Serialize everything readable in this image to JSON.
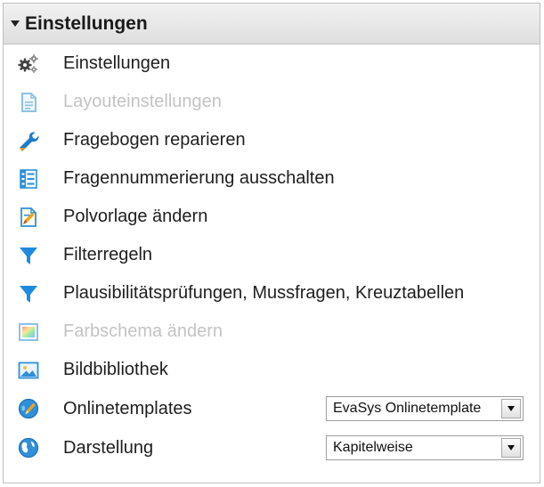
{
  "panel": {
    "title": "Einstellungen"
  },
  "items": [
    {
      "label": "Einstellungen",
      "icon": "gears-icon",
      "enabled": true
    },
    {
      "label": "Layouteinstellungen",
      "icon": "document-icon",
      "enabled": false
    },
    {
      "label": "Fragebogen reparieren",
      "icon": "wrench-icon",
      "enabled": true
    },
    {
      "label": "Fragennummerierung ausschalten",
      "icon": "numbered-list-icon",
      "enabled": true
    },
    {
      "label": "Polvorlage ändern",
      "icon": "template-edit-icon",
      "enabled": true
    },
    {
      "label": "Filterregeln",
      "icon": "filter-icon",
      "enabled": true
    },
    {
      "label": "Plausibilitätsprüfungen, Mussfragen, Kreuztabellen",
      "icon": "filter-icon",
      "enabled": true
    },
    {
      "label": "Farbschema ändern",
      "icon": "color-palette-icon",
      "enabled": false
    },
    {
      "label": "Bildbibliothek",
      "icon": "image-icon",
      "enabled": true
    },
    {
      "label": "Onlinetemplates",
      "icon": "globe-pencil-icon",
      "enabled": true,
      "select_value": "EvaSys Onlinetemplate"
    },
    {
      "label": "Darstellung",
      "icon": "globe-icon",
      "enabled": true,
      "select_value": "Kapitelweise"
    }
  ],
  "colors": {
    "accent_blue": "#2f8fd8",
    "disabled_text": "#c3c3c3",
    "header_bg": "#e6e6e6"
  }
}
